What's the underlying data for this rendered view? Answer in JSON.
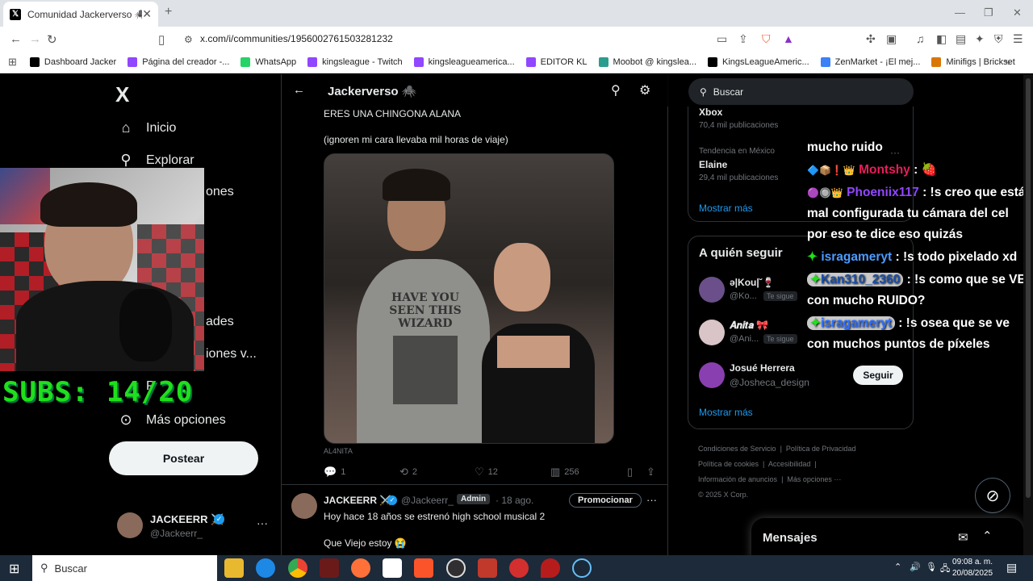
{
  "browser": {
    "tab_title": "Comunidad Jackerverso 🕷️ / X",
    "url": "x.com/i/communities/1956002761503281232",
    "bookmarks": [
      {
        "label": "Dashboard Jacker",
        "color": "#000000"
      },
      {
        "label": "Página del creador -...",
        "color": "#9146ff"
      },
      {
        "label": "WhatsApp",
        "color": "#25d366"
      },
      {
        "label": "kingsleague - Twitch",
        "color": "#9146ff"
      },
      {
        "label": "kingsleagueamerica...",
        "color": "#9146ff"
      },
      {
        "label": "EDITOR KL",
        "color": "#9146ff"
      },
      {
        "label": "Moobot @ kingslea...",
        "color": "#2a9d8f"
      },
      {
        "label": "KingsLeagueAmeric...",
        "color": "#000000"
      },
      {
        "label": "ZenMarket - ¡El mej...",
        "color": "#3b82f6"
      },
      {
        "label": "Minifigs | Brickset",
        "color": "#d97706"
      }
    ]
  },
  "nav": {
    "logo": "X",
    "items": [
      {
        "label": "Inicio",
        "icon": "home-icon"
      },
      {
        "label": "Explorar",
        "icon": "search-icon"
      },
      {
        "label": "ones",
        "icon": "bell-icon"
      },
      {
        "label": "ades",
        "icon": "communities-icon"
      },
      {
        "label": "iones v...",
        "icon": "verified-icon"
      },
      {
        "label": "P",
        "icon": "person-icon"
      },
      {
        "label": "Más opciones",
        "icon": "more-icon"
      }
    ],
    "post_button": "Postear",
    "profile_name": "JACKEERR ⚔️",
    "profile_handle": "@Jackeerr_",
    "profile_more": "···"
  },
  "overlay": {
    "subs_text": "SUBS: 14/20"
  },
  "feed": {
    "header_title": "Jackerverso 🕷️",
    "post1": {
      "line1": "ERES UNA CHINGONA ALANA",
      "line2": "(ignoren mi cara llevaba mil horas de viaje)",
      "photo_watermark": "AL4NITA",
      "shirt_text": "HAVE YOU SEEN THIS WIZARD",
      "replies": "1",
      "reposts": "2",
      "likes": "12",
      "views": "256"
    },
    "post2": {
      "name": "JACKEERR ⚔️",
      "handle": "@Jackeerr_",
      "badge": "Admin",
      "date": "· 18 ago.",
      "promote": "Promocionar",
      "text1": "Hoy hace 18 años se estrenó high school musical 2",
      "text2": "Que Viejo estoy 😭"
    }
  },
  "right": {
    "search_placeholder": "Buscar",
    "trends": [
      {
        "context": "",
        "name": "Xbox",
        "count": "70,4 mil publicaciones"
      },
      {
        "context": "Tendencia en México",
        "name": "Elaine",
        "count": "29,4 mil publicaciones"
      }
    ],
    "show_more": "Mostrar más",
    "who_to_follow_title": "A quién seguir",
    "follow": [
      {
        "name": "ə|Kou|˘🍷",
        "handle": "@Ko...",
        "follows_you": "Te sigue",
        "color": "#6b4f8a"
      },
      {
        "name": "𝑨𝒏𝒊𝒕𝒂 🎀",
        "handle": "@Ani...",
        "follows_you": "Te sigue",
        "color": "#d9c4c8"
      },
      {
        "name": "Josué Herrera",
        "handle": "@Josheca_design",
        "follows_you": "",
        "color": "#8a3fb0",
        "button": "Seguir"
      }
    ],
    "show_more2": "Mostrar más",
    "footer": {
      "l1a": "Condiciones de Servicio",
      "l1b": "Política de Privacidad",
      "l2a": "Política de cookies",
      "l2b": "Accesibilidad",
      "l3a": "Información de anuncios",
      "l3b": "Más opciones ···",
      "copyright": "© 2025 X Corp."
    },
    "messages_title": "Mensajes"
  },
  "chat": {
    "line0": "mucho ruido",
    "line1_user": "Montshy",
    "line1_msg": ": 🍓",
    "line2_user": "Phoeniix117",
    "line2_msg": ": !s creo que está mal configurada tu cámara del cel por eso te dice eso quizás",
    "line3_user": "isragameryt",
    "line3_msg": ": !s todo pixelado xd",
    "line4_user": "Kan310_2360",
    "line4_msg": ": !s como que se VE con mucho RUIDO?",
    "line5_user": "isragameryt",
    "line5_msg": ": !s osea que se ve con muchos puntos de píxeles"
  },
  "taskbar": {
    "search": "Buscar",
    "time": "09:08 a. m.",
    "date": "20/08/2025"
  }
}
